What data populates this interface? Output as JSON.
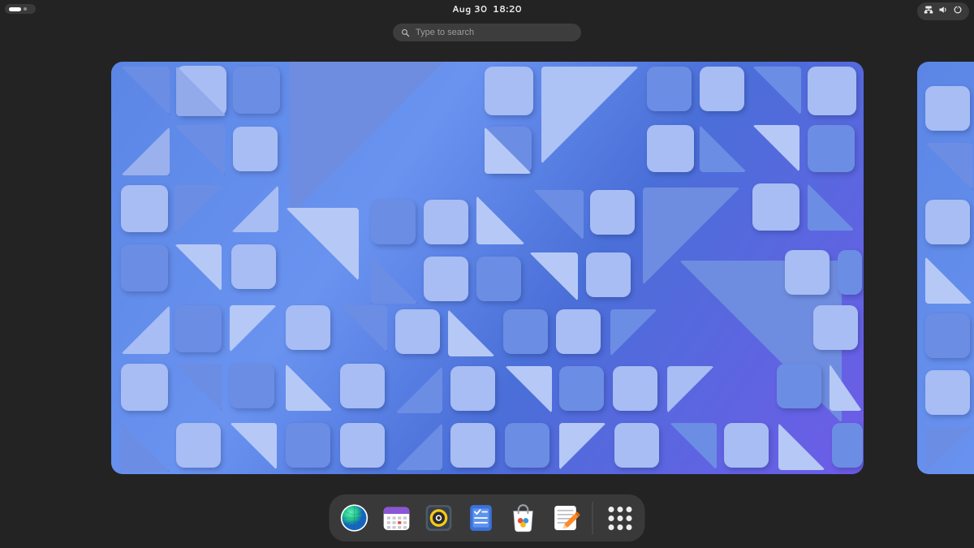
{
  "topbar": {
    "date": "Aug 30",
    "time": "18:20"
  },
  "search": {
    "placeholder": "Type to search"
  },
  "status": {
    "network_icon": "network-wired-icon",
    "volume_icon": "volume-icon",
    "power_icon": "power-icon"
  },
  "dock": {
    "apps": [
      {
        "id": "web-browser",
        "name": "Web"
      },
      {
        "id": "calendar",
        "name": "Calendar"
      },
      {
        "id": "music",
        "name": "Rhythmbox"
      },
      {
        "id": "todo",
        "name": "To Do"
      },
      {
        "id": "software",
        "name": "Software"
      },
      {
        "id": "text-editor",
        "name": "Text Editor"
      }
    ],
    "show_apps_label": "Show Apps"
  }
}
